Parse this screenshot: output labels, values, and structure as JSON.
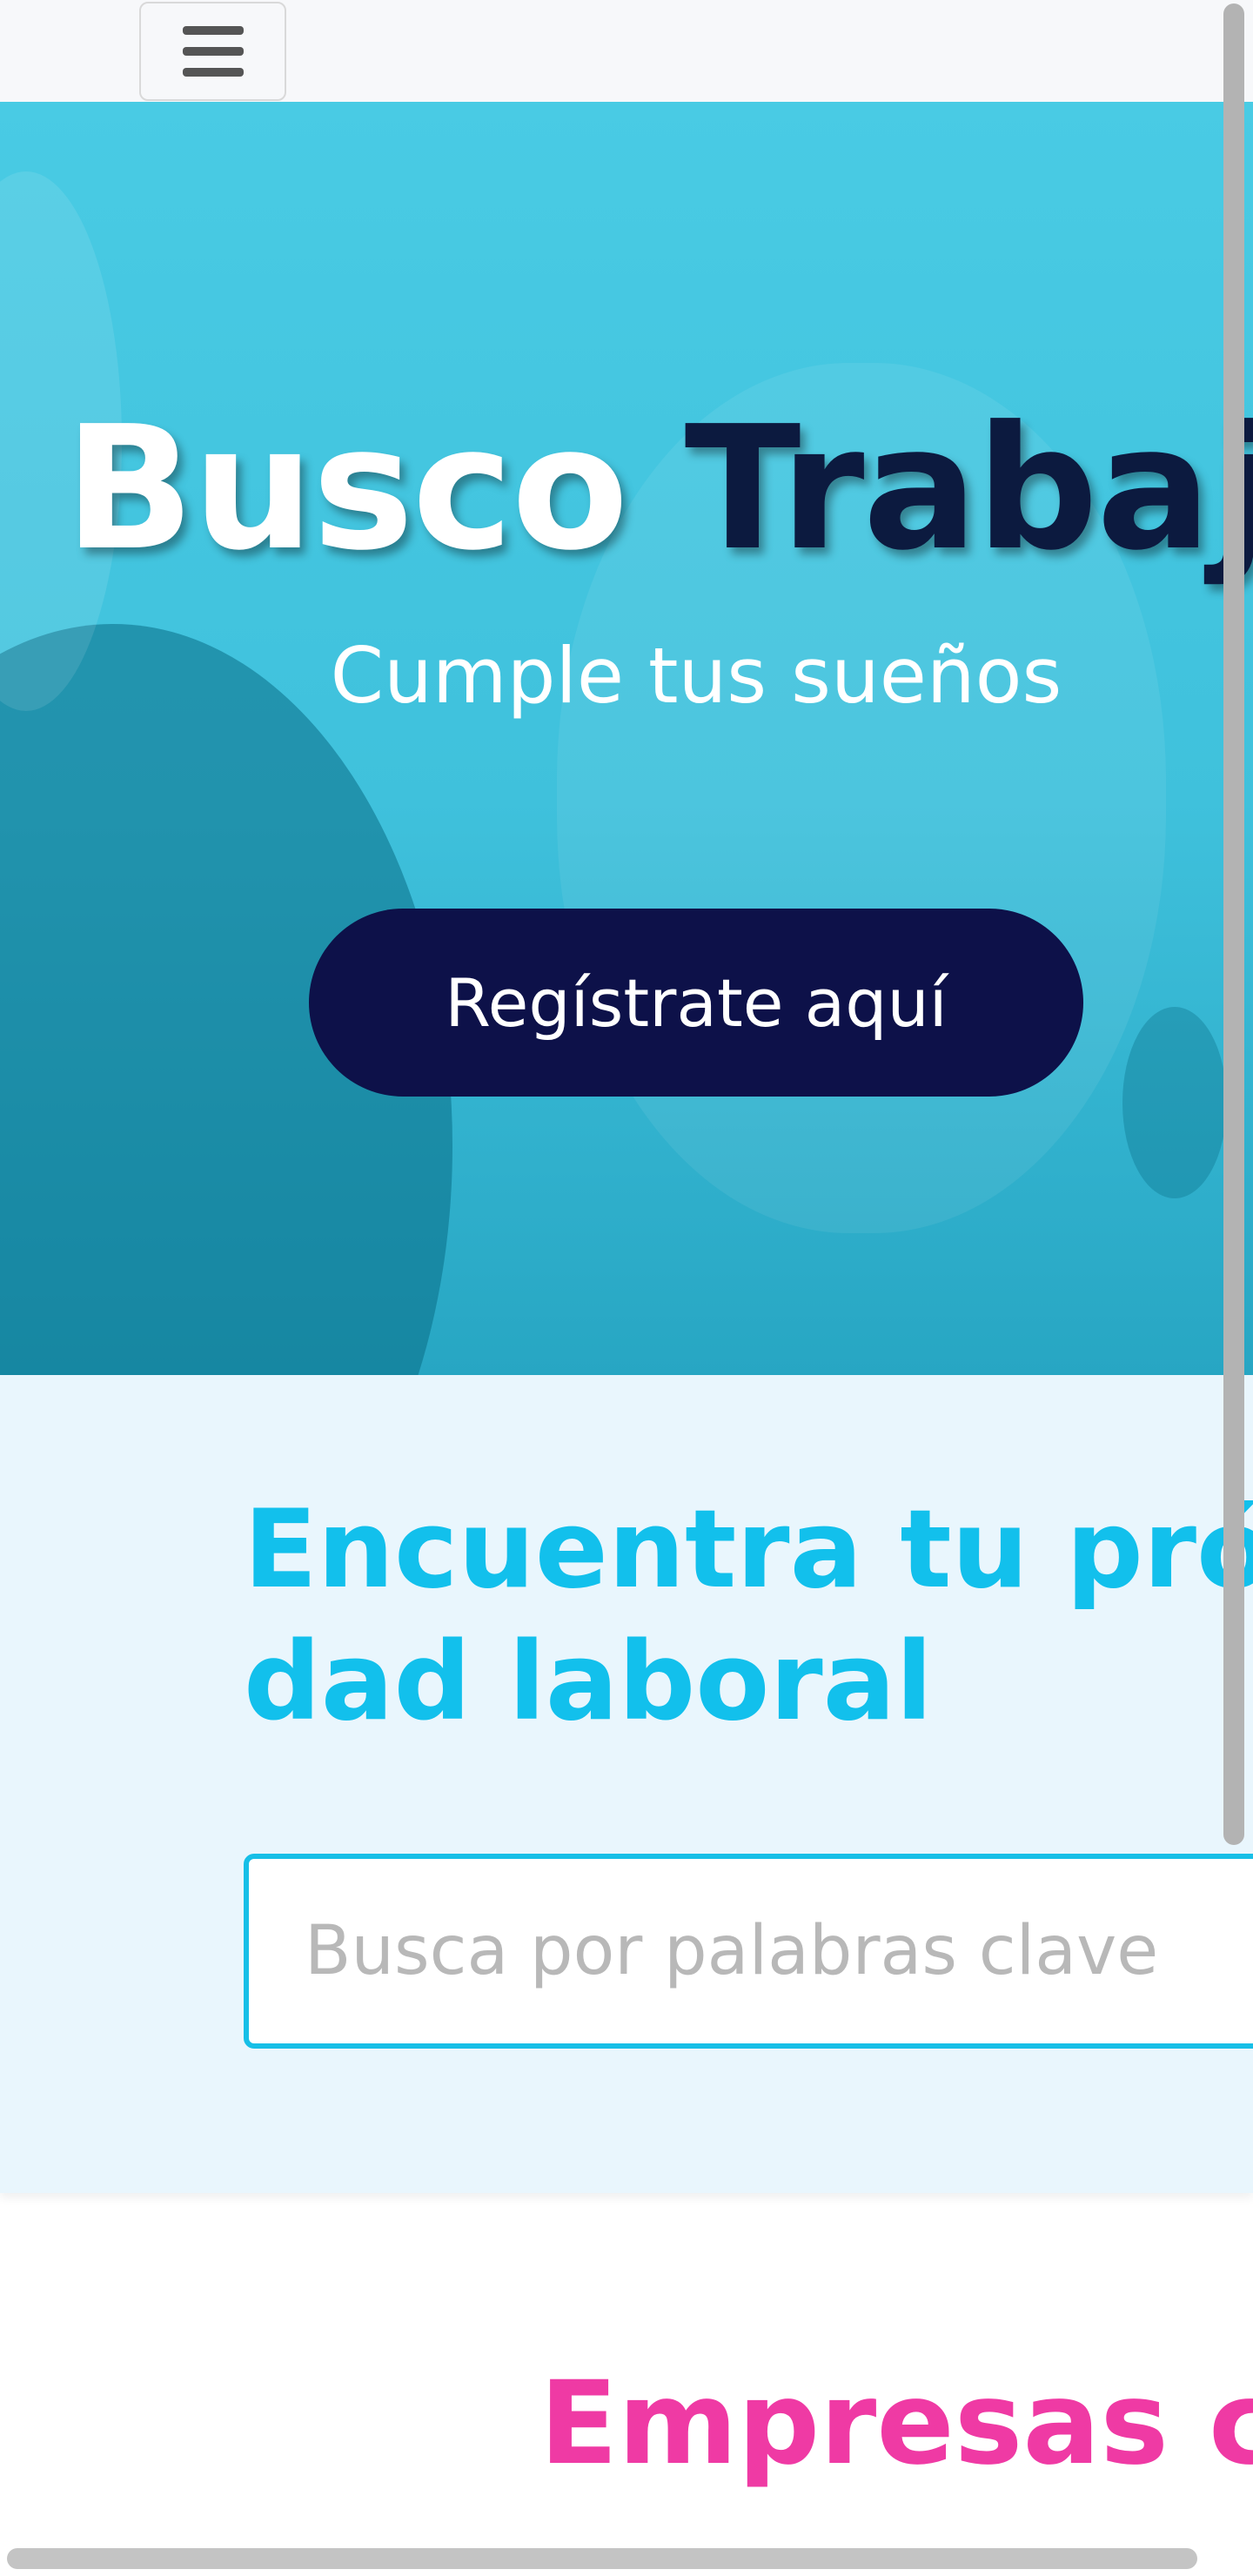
{
  "header": {
    "menu_icon": "hamburger-menu-icon"
  },
  "hero": {
    "title_word1": "Busco",
    "title_word2": "Trabajo",
    "subtitle": "Cumple tus sueños",
    "cta_label": "Regístrate aquí"
  },
  "search": {
    "heading_line1": "Encuentra tu próxima oportuni-",
    "heading_line2": "dad laboral",
    "placeholder": "Busca por palabras clave",
    "value": ""
  },
  "companies": {
    "title": "Empresas con las que trabajamos"
  },
  "colors": {
    "hero_bg": "#49cbe4",
    "navy": "#0d1149",
    "cyan_accent": "#12c0ec",
    "pink_accent": "#ef3aa4",
    "search_bg": "#e9f6fd"
  }
}
